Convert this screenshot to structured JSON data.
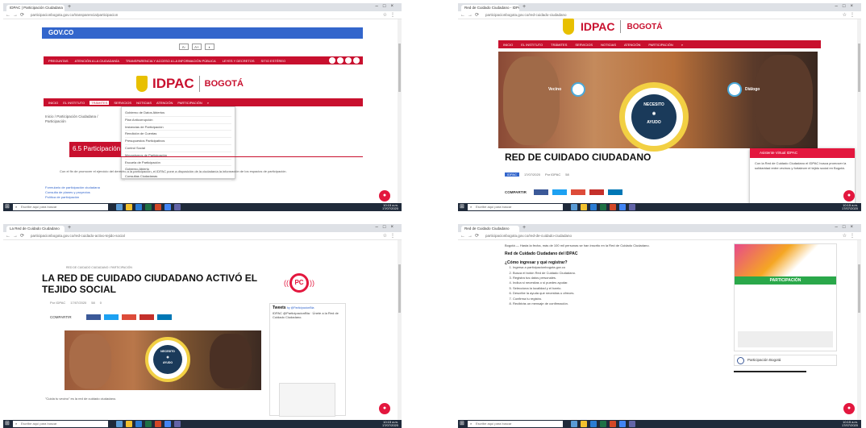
{
  "browser": {
    "tab_p1": "IDPAC | Participación Ciudadana",
    "tab_p2": "Red de Cuidado Ciudadano - IDPAC",
    "tab_p3": "La Red de Cuidado Ciudadano",
    "tab_p4": "Red de Cuidado Ciudadano",
    "url_p1": "participacionbogota.gov.co/transparencia/participacion",
    "url_p2": "participacionbogota.gov.co/red-cuidado-ciudadano",
    "url_p3": "participacionbogota.gov.co/red-cuidado-activo-tejido-social",
    "url_p4": "participacionbogota.gov.co/red-de-cuidado-ciudadano",
    "search_placeholder": "Escribe aquí para buscar"
  },
  "p1": {
    "gov_logo": "GOV.CO",
    "acc": [
      "A-",
      "A+",
      "◐"
    ],
    "top_links": [
      "PREGUNTAS",
      "ATENCIÓN A LA CIUDADANÍA",
      "TRANSPARENCIA Y ACCESO A LA INFORMACIÓN PÚBLICA",
      "LEYES Y DECRETOS",
      "SITIO ESTÉREO"
    ],
    "logo_idpac": "IDPAC",
    "logo_bogota": "BOGOTÁ",
    "nav": [
      "INICIO",
      "EL INSTITUTO",
      "TRÁMITES",
      "SERVICIOS",
      "NOTICIAS",
      "ATENCIÓN",
      "PARTICIPACIÓN"
    ],
    "nav_active_index": 2,
    "breadcrumb": "Inicio / Participación Ciudadana / Participación",
    "dropdown": [
      "Gobierno de Datos Abiertos",
      "Plan Anticorrupción",
      "Instancias de Participación",
      "Rendición de Cuentas",
      "Presupuestos Participativos",
      "Control Social",
      "Mecanismos de Participación",
      "Escuela de Participación",
      "Gobierno Abierto",
      "Consultas Ciudadanas"
    ],
    "section_title": "6.5 Participación",
    "body": "Con el fin de promover el ejercicio del derecho a la participación, el IDPAC pone a disposición de la ciudadanía la información de los espacios de participación.",
    "links": [
      "Formulario de participación ciudadana",
      "Consulta de planes y proyectos",
      "Política de participación"
    ]
  },
  "p2": {
    "logo_idpac": "IDPAC",
    "logo_bogota": "BOGOTÁ",
    "nav": [
      "INICIO",
      "EL INSTITUTO",
      "TRÁMITES",
      "SERVICIOS",
      "NOTICIAS",
      "ATENCIÓN",
      "PARTICIPACIÓN"
    ],
    "hero_text": [
      "NECESITO",
      "AYUDO"
    ],
    "hero_left": "Vecino",
    "hero_right": "Diálogo",
    "title": "RED DE CUIDADO CIUDADANO",
    "meta": [
      "IDPAC",
      "17/07/2020",
      "Por IDPAC",
      "58"
    ],
    "share_label": "COMPARTIR",
    "assistant_title": "Asistente Virtual IDPAC",
    "assistant_body": "Con la Red de Cuidado Ciudadano el IDPAC busca promover la solidaridad entre vecinos y fortalecer el tejido social en Bogotá."
  },
  "p3": {
    "kicker": "RED DE CUIDADO CIUDADANO / PARTICIPACIÓN",
    "title": "LA RED DE CUIDADO CIUDADANO ACTIVÓ EL TEJIDO SOCIAL",
    "meta": [
      "Por IDPAC",
      "17/07/2020",
      "58",
      "0"
    ],
    "share_label": "COMPARTIR",
    "pc_logo": "PC",
    "hero_text": [
      "NECESITO",
      "AYUDO"
    ],
    "caption": "\"Cuida tu vecino\" es la red de cuidado ciudadano.",
    "tweets_title": "Tweets",
    "tweets_by": "by @ParticipacionBta",
    "tweet": "IDPAC @ParticipacionBta · Únete a la Red de Cuidado Ciudadano."
  },
  "p4": {
    "intro": "Bogotá — Hasta la fecha, más de 100 mil personas se han inscrito en la Red de Cuidado Ciudadano.",
    "heading1": "Red de Cuidado Ciudadano del IDPAC",
    "heading2": "¿Cómo ingresar y qué registrar?",
    "steps": [
      "Ingresa a participacionbogota.gov.co",
      "Busca el botón Red de Cuidado Ciudadano.",
      "Registra tus datos personales.",
      "Indica si necesitas o si puedes ayudar.",
      "Selecciona la localidad y el barrio.",
      "Describe la ayuda que necesitas u ofreces.",
      "Confirma tu registro.",
      "Recibirás un mensaje de confirmación."
    ],
    "poster_band": "PARTICIPACIÓN",
    "fb_page": "Participación Bogotá"
  },
  "taskbar_time": [
    "10:15 a.m.",
    "17/07/2020"
  ],
  "colors": {
    "red": "#c8102e",
    "gov_blue": "#3366cc",
    "chat": "#e3173e"
  }
}
